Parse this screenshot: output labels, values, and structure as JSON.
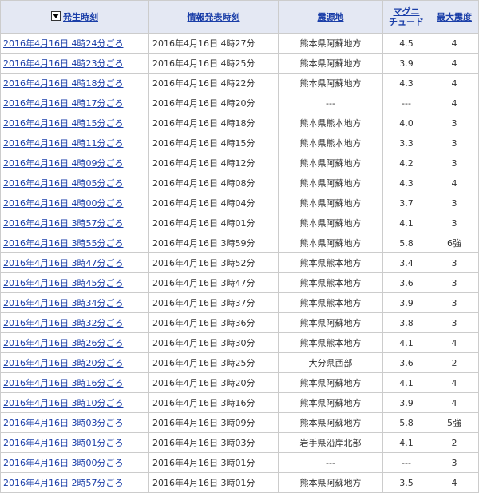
{
  "headers": {
    "occurred": "発生時刻",
    "published": "情報発表時刻",
    "epicenter": "震源地",
    "magnitude_line1": "マグニ",
    "magnitude_line2": "チュード",
    "max_intensity": "最大震度",
    "sort_icon": "sort-descending-icon"
  },
  "rows": [
    {
      "occurred": "2016年4月16日 4時24分ごろ",
      "published": "2016年4月16日 4時27分",
      "epicenter": "熊本県阿蘇地方",
      "magnitude": "4.5",
      "intensity": "4"
    },
    {
      "occurred": "2016年4月16日 4時23分ごろ",
      "published": "2016年4月16日 4時25分",
      "epicenter": "熊本県阿蘇地方",
      "magnitude": "3.9",
      "intensity": "4"
    },
    {
      "occurred": "2016年4月16日 4時18分ごろ",
      "published": "2016年4月16日 4時22分",
      "epicenter": "熊本県阿蘇地方",
      "magnitude": "4.3",
      "intensity": "4"
    },
    {
      "occurred": "2016年4月16日 4時17分ごろ",
      "published": "2016年4月16日 4時20分",
      "epicenter": "---",
      "magnitude": "---",
      "intensity": "4"
    },
    {
      "occurred": "2016年4月16日 4時15分ごろ",
      "published": "2016年4月16日 4時18分",
      "epicenter": "熊本県熊本地方",
      "magnitude": "4.0",
      "intensity": "3"
    },
    {
      "occurred": "2016年4月16日 4時11分ごろ",
      "published": "2016年4月16日 4時15分",
      "epicenter": "熊本県熊本地方",
      "magnitude": "3.3",
      "intensity": "3"
    },
    {
      "occurred": "2016年4月16日 4時09分ごろ",
      "published": "2016年4月16日 4時12分",
      "epicenter": "熊本県阿蘇地方",
      "magnitude": "4.2",
      "intensity": "3"
    },
    {
      "occurred": "2016年4月16日 4時05分ごろ",
      "published": "2016年4月16日 4時08分",
      "epicenter": "熊本県阿蘇地方",
      "magnitude": "4.3",
      "intensity": "4"
    },
    {
      "occurred": "2016年4月16日 4時00分ごろ",
      "published": "2016年4月16日 4時04分",
      "epicenter": "熊本県阿蘇地方",
      "magnitude": "3.7",
      "intensity": "3"
    },
    {
      "occurred": "2016年4月16日 3時57分ごろ",
      "published": "2016年4月16日 4時01分",
      "epicenter": "熊本県阿蘇地方",
      "magnitude": "4.1",
      "intensity": "3"
    },
    {
      "occurred": "2016年4月16日 3時55分ごろ",
      "published": "2016年4月16日 3時59分",
      "epicenter": "熊本県阿蘇地方",
      "magnitude": "5.8",
      "intensity": "6強"
    },
    {
      "occurred": "2016年4月16日 3時47分ごろ",
      "published": "2016年4月16日 3時52分",
      "epicenter": "熊本県熊本地方",
      "magnitude": "3.4",
      "intensity": "3"
    },
    {
      "occurred": "2016年4月16日 3時45分ごろ",
      "published": "2016年4月16日 3時47分",
      "epicenter": "熊本県熊本地方",
      "magnitude": "3.6",
      "intensity": "3"
    },
    {
      "occurred": "2016年4月16日 3時34分ごろ",
      "published": "2016年4月16日 3時37分",
      "epicenter": "熊本県熊本地方",
      "magnitude": "3.9",
      "intensity": "3"
    },
    {
      "occurred": "2016年4月16日 3時32分ごろ",
      "published": "2016年4月16日 3時36分",
      "epicenter": "熊本県阿蘇地方",
      "magnitude": "3.8",
      "intensity": "3"
    },
    {
      "occurred": "2016年4月16日 3時26分ごろ",
      "published": "2016年4月16日 3時30分",
      "epicenter": "熊本県熊本地方",
      "magnitude": "4.1",
      "intensity": "4"
    },
    {
      "occurred": "2016年4月16日 3時20分ごろ",
      "published": "2016年4月16日 3時25分",
      "epicenter": "大分県西部",
      "magnitude": "3.6",
      "intensity": "2"
    },
    {
      "occurred": "2016年4月16日 3時16分ごろ",
      "published": "2016年4月16日 3時20分",
      "epicenter": "熊本県阿蘇地方",
      "magnitude": "4.1",
      "intensity": "4"
    },
    {
      "occurred": "2016年4月16日 3時10分ごろ",
      "published": "2016年4月16日 3時16分",
      "epicenter": "熊本県阿蘇地方",
      "magnitude": "3.9",
      "intensity": "4"
    },
    {
      "occurred": "2016年4月16日 3時03分ごろ",
      "published": "2016年4月16日 3時09分",
      "epicenter": "熊本県阿蘇地方",
      "magnitude": "5.8",
      "intensity": "5強"
    },
    {
      "occurred": "2016年4月16日 3時01分ごろ",
      "published": "2016年4月16日 3時03分",
      "epicenter": "岩手県沿岸北部",
      "magnitude": "4.1",
      "intensity": "2"
    },
    {
      "occurred": "2016年4月16日 3時00分ごろ",
      "published": "2016年4月16日 3時01分",
      "epicenter": "---",
      "magnitude": "---",
      "intensity": "3"
    },
    {
      "occurred": "2016年4月16日 2時57分ごろ",
      "published": "2016年4月16日 3時01分",
      "epicenter": "熊本県阿蘇地方",
      "magnitude": "3.5",
      "intensity": "4"
    }
  ]
}
